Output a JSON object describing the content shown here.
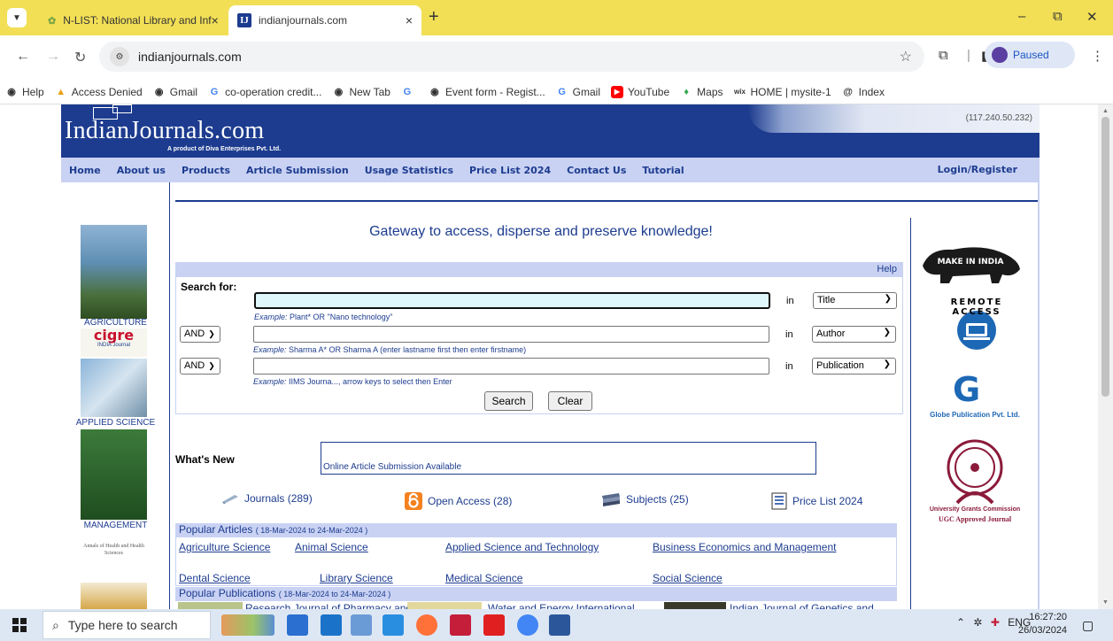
{
  "browser": {
    "tabs": [
      {
        "title": "N-LIST: National Library and Inf",
        "icon": "nlist-favicon"
      },
      {
        "title": "indianjournals.com",
        "icon": "indianjournals-favicon",
        "close": "×"
      }
    ],
    "new_tab": "+",
    "window_buttons": {
      "minimize": "–",
      "restore": "⧉",
      "close": "✕"
    },
    "url": "indianjournals.com",
    "profile_status": "Paused",
    "bookmarks": [
      {
        "label": "Help",
        "icon": "globe-icon"
      },
      {
        "label": "Access Denied",
        "icon": "drive-icon"
      },
      {
        "label": "Gmail",
        "icon": "globe-icon"
      },
      {
        "label": "co-operation credit...",
        "icon": "google-icon"
      },
      {
        "label": "New Tab",
        "icon": "globe-icon"
      },
      {
        "label": "",
        "icon": "google-icon"
      },
      {
        "label": "Event form - Regist...",
        "icon": "globe-icon"
      },
      {
        "label": "Gmail",
        "icon": "google-icon"
      },
      {
        "label": "YouTube",
        "icon": "youtube-icon"
      },
      {
        "label": "Maps",
        "icon": "maps-icon"
      },
      {
        "label": "HOME | mysite-1",
        "icon": "wix-icon"
      },
      {
        "label": "Index",
        "icon": "at-icon"
      }
    ]
  },
  "site": {
    "logo_text": "IndianJournals.com",
    "logo_tagline": "A product of Diva Enterprises Pvt. Ltd.",
    "ip_address": "(117.240.50.232)",
    "nav": [
      "Home",
      "About us",
      "Products",
      "Article Submission",
      "Usage Statistics",
      "Price List 2024",
      "Contact Us",
      "Tutorial"
    ],
    "login": "Login/Register",
    "tagline": "Gateway to access, disperse and preserve knowledge!"
  },
  "left_covers": [
    {
      "label": "AGRICULTURE"
    },
    {
      "label": "APPLIED SCIENCE"
    },
    {
      "label": "MANAGEMENT"
    }
  ],
  "cover_texts": {
    "cigre": "cigre",
    "cigre_sub": "INDIA Journal",
    "annals": "Annals of Health and Health Sciences"
  },
  "search": {
    "help": "Help",
    "search_for": "Search for:",
    "in_label": "in",
    "rows": [
      {
        "bool": "",
        "field": "Title",
        "example_prefix": "Example:",
        "example": " Plant* OR \"Nano technology\""
      },
      {
        "bool": "AND",
        "field": "Author",
        "example_prefix": "Example:",
        "example": " Sharma A* OR Sharma A (enter lastname first then enter firstname)"
      },
      {
        "bool": "AND",
        "field": "Publication",
        "example_prefix": "Example:",
        "example": " IIMS Journa..., arrow keys to select then Enter"
      }
    ],
    "search_button": "Search",
    "clear_button": "Clear"
  },
  "whats_new": {
    "label": "What's New",
    "item": "Online Article Submission Available"
  },
  "quick_links": [
    {
      "label": "Journals (289)",
      "icon": "pencil-icon"
    },
    {
      "label": "Open Access (28)",
      "icon": "open-access-icon"
    },
    {
      "label": "Subjects (25)",
      "icon": "books-icon"
    },
    {
      "label": "Price List 2024",
      "icon": "price-list-icon"
    }
  ],
  "popular_articles": {
    "title": "Popular Articles",
    "range": "( 18-Mar-2024 to 24-Mar-2024 )",
    "links": [
      "Agriculture Science",
      "Animal Science",
      "Applied Science and Technology",
      "Business Economics and Management",
      "Dental Science",
      "Library Science",
      "Medical Science",
      "Social Science"
    ]
  },
  "popular_publications": {
    "title": "Popular Publications",
    "range": "( 18-Mar-2024 to 24-Mar-2024 )",
    "items": [
      "Research Journal of Pharmacy and",
      "Water and Energy International",
      "Indian Journal of Genetics and"
    ]
  },
  "right_logos": {
    "make_in_india": "MAKE IN INDIA",
    "remote_access": "REMOTE ACCESS",
    "globe": "Globe Publication Pvt. Ltd.",
    "ugc": "University Grants Commission",
    "ugc_approved": "UGC Approved Journal"
  },
  "taskbar": {
    "search_placeholder": "Type here to search",
    "tray_lang": "ENG",
    "time": "16:27:20",
    "date": "26/03/2024"
  },
  "colors": {
    "brand": "#1d3c8f",
    "nav_bg": "#c9d2f3",
    "tab_bar": "#f2df56"
  }
}
